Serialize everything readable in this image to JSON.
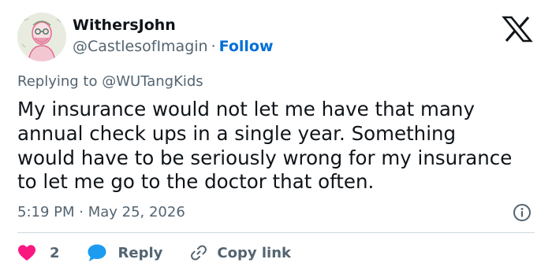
{
  "author": {
    "name": "WithersJohn",
    "handle": "@CastlesofImagin",
    "separator": "·",
    "follow_label": "Follow"
  },
  "reply_context": {
    "prefix": "Replying to",
    "mention": "@WUTangKids"
  },
  "body": "My insurance would not let me have that many\nannual check ups in a single year. Something\nwould have to be seriously wrong for my insurance\nto let me go to the doctor that often.",
  "timestamp": "5:19 PM · May 25, 2026",
  "actions": {
    "like_count": "2",
    "reply_label": "Reply",
    "copy_label": "Copy link"
  },
  "colors": {
    "link": "#006fd6",
    "like": "#f91880",
    "reply": "#1d9bf0",
    "secondary_text": "#536471"
  },
  "icons": [
    "x-logo-icon",
    "info-icon",
    "heart-icon",
    "speech-bubble-icon",
    "link-icon"
  ]
}
